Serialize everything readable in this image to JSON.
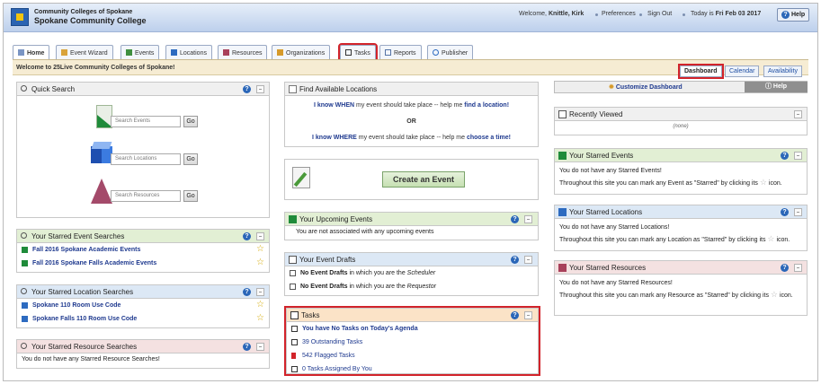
{
  "header": {
    "org_line1": "Community Colleges of Spokane",
    "org_line2": "Spokane Community College",
    "welcome_prefix": "Welcome, ",
    "user": "Knittle, Kirk",
    "preferences": "Preferences",
    "sign_out": "Sign Out",
    "today_prefix": "Today is ",
    "today": "Fri Feb 03 2017",
    "help": "Help"
  },
  "tabs": [
    {
      "label": "Home",
      "icon": "home-icon"
    },
    {
      "label": "Event Wizard",
      "icon": "wizard-icon"
    },
    {
      "label": "Events",
      "icon": "events-icon"
    },
    {
      "label": "Locations",
      "icon": "locations-icon"
    },
    {
      "label": "Resources",
      "icon": "resources-icon"
    },
    {
      "label": "Organizations",
      "icon": "organizations-icon"
    },
    {
      "label": "Tasks",
      "icon": "tasks-icon"
    },
    {
      "label": "Reports",
      "icon": "reports-icon"
    },
    {
      "label": "Publisher",
      "icon": "publisher-icon"
    }
  ],
  "welcome_bar": {
    "text": "Welcome to 25Live Community Colleges of Spokane!",
    "views": [
      "Dashboard",
      "Calendar",
      "Availability"
    ]
  },
  "quick_search": {
    "title": "Quick Search",
    "events_placeholder": "Search Events",
    "locations_placeholder": "Search Locations",
    "resources_placeholder": "Search Resources",
    "go": "Go"
  },
  "starred_event_searches": {
    "title": "Your Starred Event Searches",
    "items": [
      "Fall 2016 Spokane Academic Events",
      "Fall 2016 Spokane Falls Academic Events"
    ]
  },
  "starred_location_searches": {
    "title": "Your Starred Location Searches",
    "items": [
      "Spokane 110 Room Use Code",
      "Spokane Falls 110 Room Use Code"
    ]
  },
  "starred_resource_searches": {
    "title": "Your Starred Resource Searches",
    "empty": "You do not have any Starred Resource Searches!"
  },
  "find_locations": {
    "title": "Find Available Locations",
    "line1_prefix": "I know WHEN",
    "line1_mid": " my event should take place -- help me ",
    "line1_link": "find a location!",
    "or": "OR",
    "line2_prefix": "I know WHERE",
    "line2_mid": " my event should take place -- help me ",
    "line2_link": "choose a time!"
  },
  "create_event": {
    "button": "Create an Event"
  },
  "upcoming_events": {
    "title": "Your Upcoming Events",
    "empty": "You are not associated with any upcoming events"
  },
  "event_drafts": {
    "title": "Your Event Drafts",
    "row1_bold": "No Event Drafts",
    "row1_rest": " in which you are the ",
    "row1_role": "Scheduler",
    "row2_bold": "No Event Drafts",
    "row2_rest": " in which you are the ",
    "row2_role": "Requestor"
  },
  "tasks": {
    "title": "Tasks",
    "items": [
      {
        "label": "You have No Tasks on Today's Agenda",
        "bold": true
      },
      {
        "label": "39 Outstanding Tasks",
        "bold": false
      },
      {
        "label": "542 Flagged Tasks",
        "bold": false
      },
      {
        "label": "0 Tasks Assigned By You",
        "bold": false
      }
    ]
  },
  "dashboard_toolbar": {
    "customize": "Customize Dashboard",
    "help": "Help"
  },
  "recently_viewed": {
    "title": "Recently Viewed",
    "empty": "(none)"
  },
  "starred_events": {
    "title": "Your Starred Events",
    "empty": "You do not have any Starred Events!",
    "hint": "Throughout this site you can mark any Event as \"Starred\" by clicking its",
    "icon_word": "icon."
  },
  "starred_locations": {
    "title": "Your Starred Locations",
    "empty": "You do not have any Starred Locations!",
    "hint": "Throughout this site you can mark any Location as \"Starred\" by clicking its",
    "icon_word": "icon."
  },
  "starred_resources": {
    "title": "Your Starred Resources",
    "empty": "You do not have any Starred Resources!",
    "hint": "Throughout this site you can mark any Resource as \"Starred\" by clicking its",
    "icon_word": "icon."
  }
}
